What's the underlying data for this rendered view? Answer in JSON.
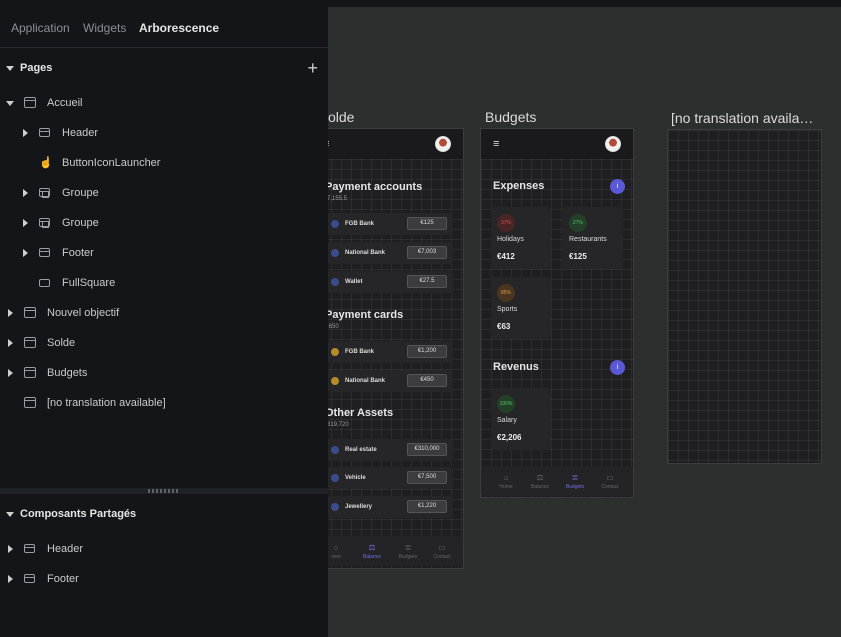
{
  "panel": {
    "tabs": [
      "Application",
      "Widgets",
      "Arborescence"
    ],
    "active_tab": "Arborescence",
    "pages_header": "Pages",
    "tree": [
      {
        "label": "Accueil",
        "level": 0,
        "icon": "page-icon"
      },
      {
        "label": "Header",
        "level": 1,
        "icon": "layout-icon"
      },
      {
        "label": "ButtonIconLauncher",
        "level": 1,
        "icon": "hand-pointer-icon"
      },
      {
        "label": "Groupe",
        "level": 1,
        "icon": "group-icon"
      },
      {
        "label": "Groupe",
        "level": 1,
        "icon": "group-icon"
      },
      {
        "label": "Footer",
        "level": 1,
        "icon": "layout-icon"
      },
      {
        "label": "FullSquare",
        "level": 1,
        "icon": "rectangle-icon"
      },
      {
        "label": "Nouvel objectif",
        "level": 0,
        "icon": "page-icon"
      },
      {
        "label": "Solde",
        "level": 0,
        "icon": "page-icon"
      },
      {
        "label": "Budgets",
        "level": 0,
        "icon": "page-icon"
      },
      {
        "label": "[no translation available]",
        "level": 0,
        "icon": "page-icon"
      }
    ],
    "shared_header": "Composants Partagés",
    "shared": [
      {
        "label": "Header",
        "icon": "layout-icon"
      },
      {
        "label": "Footer",
        "icon": "layout-icon"
      }
    ]
  },
  "canvas": {
    "frames": [
      "olde",
      "Budgets",
      "[no translation availa…"
    ],
    "solde": {
      "payment_accounts_title": "Payment accounts",
      "payment_accounts_total": "7,155.5",
      "accounts": [
        {
          "name": "FGB Bank",
          "value": "€125"
        },
        {
          "name": "National Bank",
          "value": "€7,003"
        },
        {
          "name": "Wallet",
          "value": "€27.5"
        }
      ],
      "payment_cards_title": "Payment cards",
      "payment_cards_total": ",650",
      "cards": [
        {
          "name": "FGB Bank",
          "value": "€1,200"
        },
        {
          "name": "National Bank",
          "value": "€450"
        }
      ],
      "other_assets_title": "Other Assets",
      "other_assets_total": "319,720",
      "assets": [
        {
          "name": "Real estate",
          "value": "€310,000"
        },
        {
          "name": "Vehicle",
          "value": "€7,500"
        },
        {
          "name": "Jewellery",
          "value": "€1,220"
        }
      ],
      "tabbar": [
        "ome",
        "Balance",
        "Budgets",
        "Contact"
      ],
      "active_tab": "Balance"
    },
    "budgets": {
      "expenses_title": "Expenses",
      "expenses": [
        {
          "pct": "37%",
          "name": "Holidays",
          "value": "€412",
          "color": "#a23a3a"
        },
        {
          "pct": "27%",
          "name": "Restaurants",
          "value": "€125",
          "color": "#3f8a4a"
        },
        {
          "pct": "85%",
          "name": "Sports",
          "value": "€63",
          "color": "#b87a2a"
        }
      ],
      "revenus_title": "Revenus",
      "revenus": [
        {
          "pct": "100%",
          "name": "Salary",
          "value": "€2,206",
          "color": "#3f8a4a"
        }
      ],
      "tabbar": [
        "Home",
        "Balance",
        "Budgets",
        "Contact"
      ],
      "active_tab": "Budgets"
    }
  }
}
